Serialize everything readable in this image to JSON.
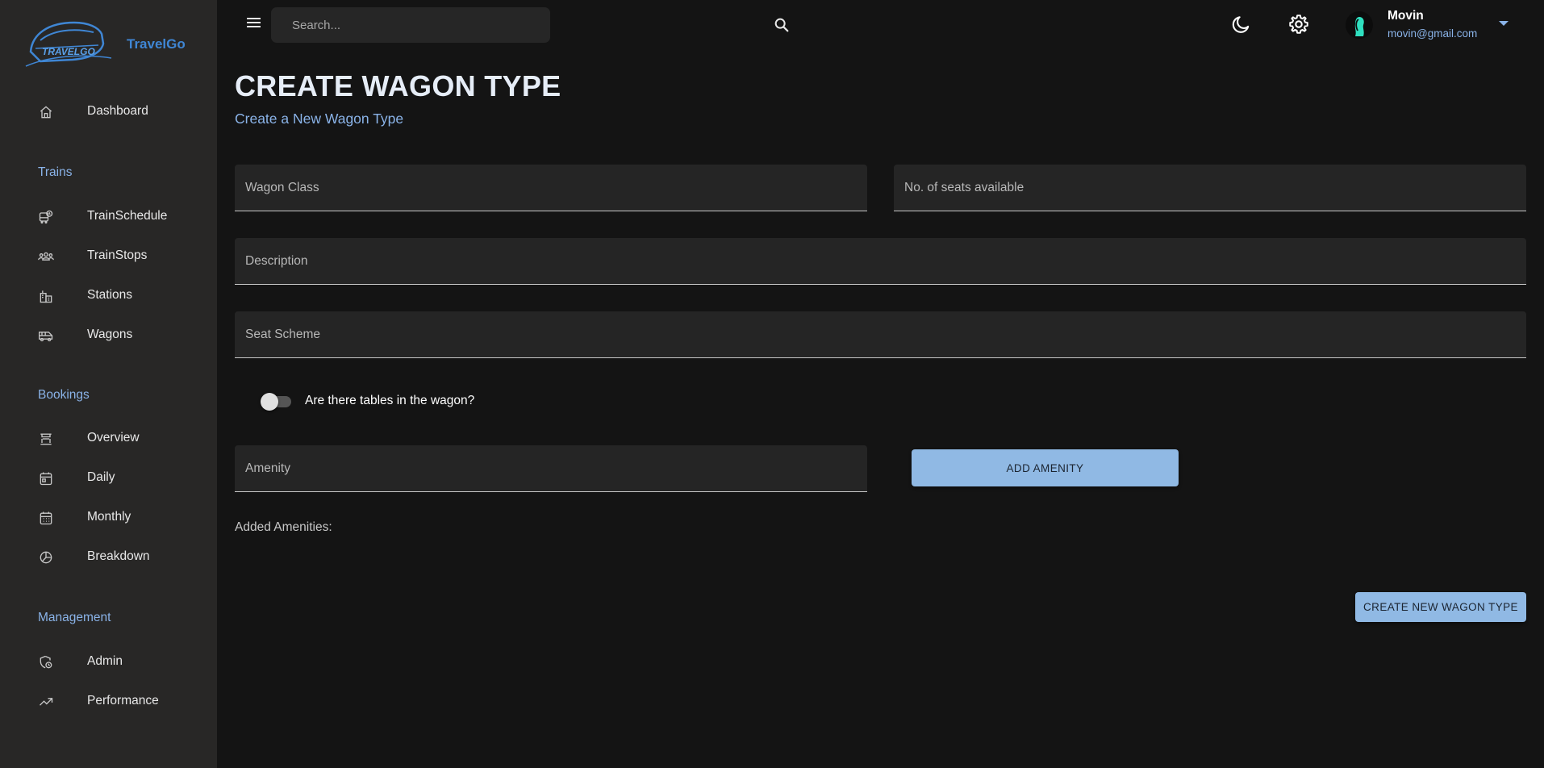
{
  "brand": {
    "name": "TravelGo",
    "logo_text": "TRAVELGO"
  },
  "header": {
    "search_placeholder": "Search...",
    "user": {
      "name": "Movin",
      "email": "movin@gmail.com"
    }
  },
  "sidebar": {
    "dashboard": {
      "label": "Dashboard",
      "icon": "home-icon"
    },
    "sections": [
      {
        "title": "Trains",
        "items": [
          {
            "label": "TrainSchedule",
            "icon": "train-schedule-icon"
          },
          {
            "label": "TrainStops",
            "icon": "people-group-icon"
          },
          {
            "label": "Stations",
            "icon": "station-building-icon"
          },
          {
            "label": "Wagons",
            "icon": "wagon-icon"
          }
        ]
      },
      {
        "title": "Bookings",
        "items": [
          {
            "label": "Overview",
            "icon": "bank-icon"
          },
          {
            "label": "Daily",
            "icon": "calendar-day-icon"
          },
          {
            "label": "Monthly",
            "icon": "calendar-month-icon"
          },
          {
            "label": "Breakdown",
            "icon": "pie-chart-icon"
          }
        ]
      },
      {
        "title": "Management",
        "items": [
          {
            "label": "Admin",
            "icon": "admin-shield-icon"
          },
          {
            "label": "Performance",
            "icon": "trending-up-icon"
          }
        ]
      }
    ]
  },
  "main": {
    "title": "CREATE WAGON TYPE",
    "subtitle": "Create a New Wagon Type",
    "fields": {
      "wagon_class": {
        "placeholder": "Wagon Class",
        "value": ""
      },
      "seats": {
        "placeholder": "No. of seats available",
        "value": ""
      },
      "description": {
        "placeholder": "Description",
        "value": ""
      },
      "seat_scheme": {
        "placeholder": "Seat Scheme",
        "value": ""
      },
      "amenity": {
        "placeholder": "Amenity",
        "value": ""
      }
    },
    "tables_toggle": {
      "label": "Are there tables in the wagon?",
      "checked": false
    },
    "add_amenity_label": "ADD AMENITY",
    "added_amenities_label": "Added Amenities:",
    "submit_label": "CREATE NEW WAGON TYPE"
  },
  "colors": {
    "accent": "#8ab3e8",
    "button": "#90b9e4",
    "sidebar_bg": "#282726",
    "page_bg": "#141414",
    "brand": "#3f86d4"
  }
}
